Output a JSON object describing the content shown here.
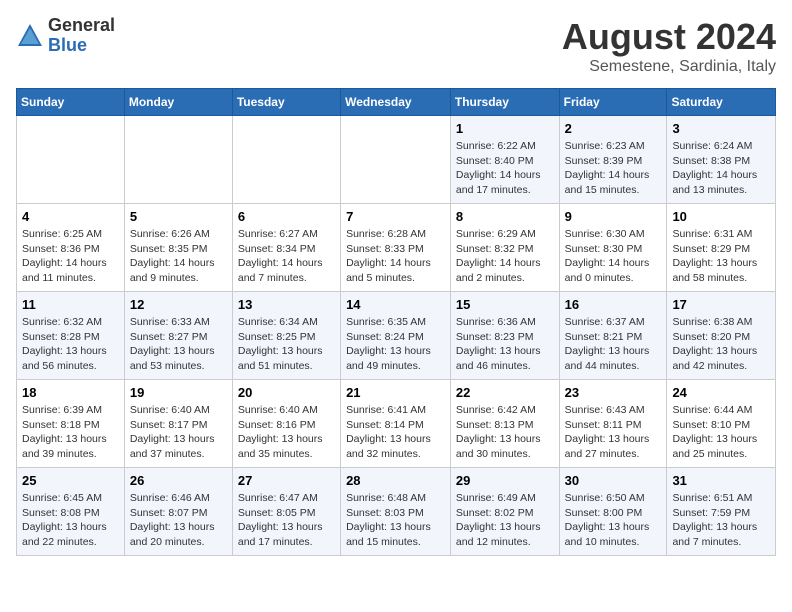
{
  "header": {
    "logo_line1": "General",
    "logo_line2": "Blue",
    "month_year": "August 2024",
    "location": "Semestene, Sardinia, Italy"
  },
  "days_of_week": [
    "Sunday",
    "Monday",
    "Tuesday",
    "Wednesday",
    "Thursday",
    "Friday",
    "Saturday"
  ],
  "weeks": [
    [
      {
        "day": "",
        "info": ""
      },
      {
        "day": "",
        "info": ""
      },
      {
        "day": "",
        "info": ""
      },
      {
        "day": "",
        "info": ""
      },
      {
        "day": "1",
        "info": "Sunrise: 6:22 AM\nSunset: 8:40 PM\nDaylight: 14 hours and 17 minutes."
      },
      {
        "day": "2",
        "info": "Sunrise: 6:23 AM\nSunset: 8:39 PM\nDaylight: 14 hours and 15 minutes."
      },
      {
        "day": "3",
        "info": "Sunrise: 6:24 AM\nSunset: 8:38 PM\nDaylight: 14 hours and 13 minutes."
      }
    ],
    [
      {
        "day": "4",
        "info": "Sunrise: 6:25 AM\nSunset: 8:36 PM\nDaylight: 14 hours and 11 minutes."
      },
      {
        "day": "5",
        "info": "Sunrise: 6:26 AM\nSunset: 8:35 PM\nDaylight: 14 hours and 9 minutes."
      },
      {
        "day": "6",
        "info": "Sunrise: 6:27 AM\nSunset: 8:34 PM\nDaylight: 14 hours and 7 minutes."
      },
      {
        "day": "7",
        "info": "Sunrise: 6:28 AM\nSunset: 8:33 PM\nDaylight: 14 hours and 5 minutes."
      },
      {
        "day": "8",
        "info": "Sunrise: 6:29 AM\nSunset: 8:32 PM\nDaylight: 14 hours and 2 minutes."
      },
      {
        "day": "9",
        "info": "Sunrise: 6:30 AM\nSunset: 8:30 PM\nDaylight: 14 hours and 0 minutes."
      },
      {
        "day": "10",
        "info": "Sunrise: 6:31 AM\nSunset: 8:29 PM\nDaylight: 13 hours and 58 minutes."
      }
    ],
    [
      {
        "day": "11",
        "info": "Sunrise: 6:32 AM\nSunset: 8:28 PM\nDaylight: 13 hours and 56 minutes."
      },
      {
        "day": "12",
        "info": "Sunrise: 6:33 AM\nSunset: 8:27 PM\nDaylight: 13 hours and 53 minutes."
      },
      {
        "day": "13",
        "info": "Sunrise: 6:34 AM\nSunset: 8:25 PM\nDaylight: 13 hours and 51 minutes."
      },
      {
        "day": "14",
        "info": "Sunrise: 6:35 AM\nSunset: 8:24 PM\nDaylight: 13 hours and 49 minutes."
      },
      {
        "day": "15",
        "info": "Sunrise: 6:36 AM\nSunset: 8:23 PM\nDaylight: 13 hours and 46 minutes."
      },
      {
        "day": "16",
        "info": "Sunrise: 6:37 AM\nSunset: 8:21 PM\nDaylight: 13 hours and 44 minutes."
      },
      {
        "day": "17",
        "info": "Sunrise: 6:38 AM\nSunset: 8:20 PM\nDaylight: 13 hours and 42 minutes."
      }
    ],
    [
      {
        "day": "18",
        "info": "Sunrise: 6:39 AM\nSunset: 8:18 PM\nDaylight: 13 hours and 39 minutes."
      },
      {
        "day": "19",
        "info": "Sunrise: 6:40 AM\nSunset: 8:17 PM\nDaylight: 13 hours and 37 minutes."
      },
      {
        "day": "20",
        "info": "Sunrise: 6:40 AM\nSunset: 8:16 PM\nDaylight: 13 hours and 35 minutes."
      },
      {
        "day": "21",
        "info": "Sunrise: 6:41 AM\nSunset: 8:14 PM\nDaylight: 13 hours and 32 minutes."
      },
      {
        "day": "22",
        "info": "Sunrise: 6:42 AM\nSunset: 8:13 PM\nDaylight: 13 hours and 30 minutes."
      },
      {
        "day": "23",
        "info": "Sunrise: 6:43 AM\nSunset: 8:11 PM\nDaylight: 13 hours and 27 minutes."
      },
      {
        "day": "24",
        "info": "Sunrise: 6:44 AM\nSunset: 8:10 PM\nDaylight: 13 hours and 25 minutes."
      }
    ],
    [
      {
        "day": "25",
        "info": "Sunrise: 6:45 AM\nSunset: 8:08 PM\nDaylight: 13 hours and 22 minutes."
      },
      {
        "day": "26",
        "info": "Sunrise: 6:46 AM\nSunset: 8:07 PM\nDaylight: 13 hours and 20 minutes."
      },
      {
        "day": "27",
        "info": "Sunrise: 6:47 AM\nSunset: 8:05 PM\nDaylight: 13 hours and 17 minutes."
      },
      {
        "day": "28",
        "info": "Sunrise: 6:48 AM\nSunset: 8:03 PM\nDaylight: 13 hours and 15 minutes."
      },
      {
        "day": "29",
        "info": "Sunrise: 6:49 AM\nSunset: 8:02 PM\nDaylight: 13 hours and 12 minutes."
      },
      {
        "day": "30",
        "info": "Sunrise: 6:50 AM\nSunset: 8:00 PM\nDaylight: 13 hours and 10 minutes."
      },
      {
        "day": "31",
        "info": "Sunrise: 6:51 AM\nSunset: 7:59 PM\nDaylight: 13 hours and 7 minutes."
      }
    ]
  ]
}
